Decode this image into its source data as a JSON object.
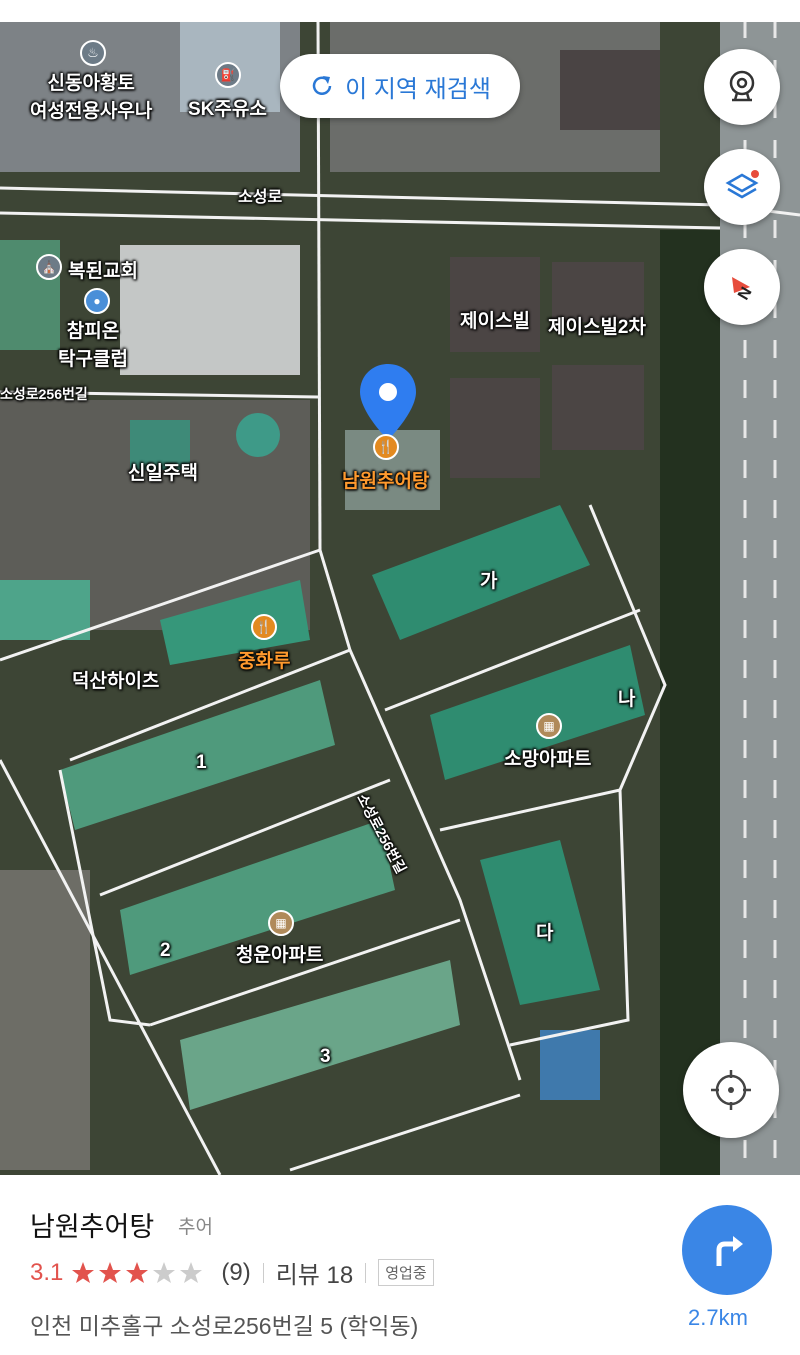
{
  "map": {
    "research_button": "이 지역 재검색",
    "labels": {
      "sauna": "신동아황토\n여성전용사우나",
      "gas_station": "SK주유소",
      "road_soseong": "소성로",
      "church": "복된교회",
      "table_tennis": "참피온\n탁구클럽",
      "road_256": "소성로256번길",
      "jays_vill": "제이스빌",
      "jays_vill_2": "제이스빌2차",
      "sinil_house": "신일주택",
      "namwon_pin": "남원추어탕",
      "ga": "가",
      "junghwaru": "중화루",
      "deoksan_heights": "덕산하이츠",
      "na": "나",
      "apt_1": "1",
      "somang_apt": "소망아파트",
      "road_256_vertical": "소성로256번길",
      "da": "다",
      "apt_2": "2",
      "cheongun_apt": "청운아파트",
      "apt_3": "3"
    },
    "controls": {
      "street_view": "street-view-icon",
      "layers": "layers-icon",
      "compass_letter": "N",
      "my_location": "my-location-icon"
    }
  },
  "place": {
    "name": "남원추어탕",
    "category": "추어",
    "rating": "3.1",
    "stars": 3.1,
    "review_count": "(9)",
    "reviews": "리뷰 18",
    "status": "영업중",
    "address": "인천 미추홀구 소성로256번길 5 (학익동)",
    "distance": "2.7km"
  },
  "colors": {
    "accent": "#3a86e6",
    "star": "#e2534d",
    "poi_orange": "#e38a20"
  }
}
